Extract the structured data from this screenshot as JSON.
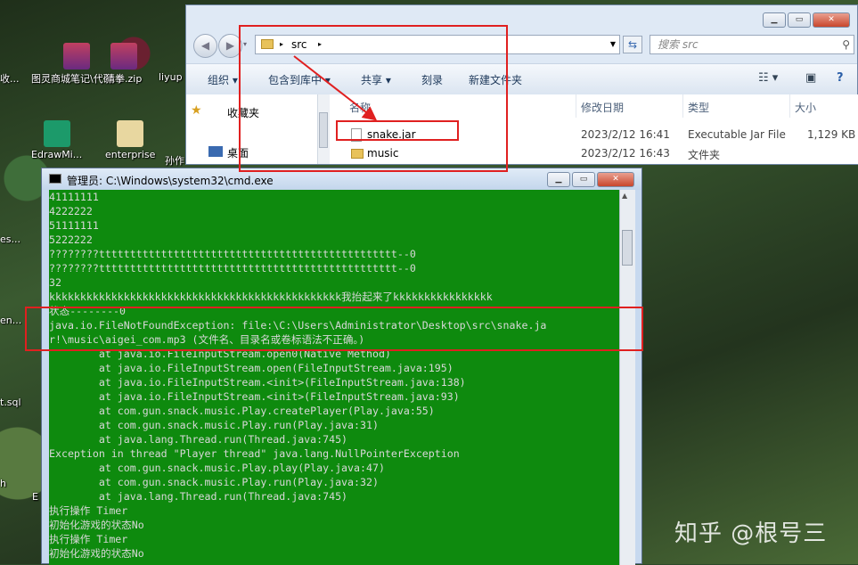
{
  "desktop": {
    "icons": [
      {
        "label": "图灵商城笔记\\代码..."
      },
      {
        "label": "猜拳.zip"
      },
      {
        "label": "liyup"
      },
      {
        "label": "EdrawMi..."
      },
      {
        "label": "enterprise"
      },
      {
        "label": "孙作"
      },
      {
        "label": "收..."
      },
      {
        "label": "es..."
      },
      {
        "label": "en..."
      },
      {
        "label": "t.sql"
      },
      {
        "label": "h"
      },
      {
        "label": "E"
      }
    ]
  },
  "explorer": {
    "address": {
      "crumb": "src",
      "sep": "▸"
    },
    "search_placeholder": "搜索 src",
    "toolbar": {
      "organize": "组织 ▾",
      "include_in_library": "包含到库中 ▾",
      "share": "共享 ▾",
      "burn": "刻录",
      "new_folder": "新建文件夹"
    },
    "nav": {
      "favorites": "收藏夹",
      "desktop": "桌面"
    },
    "columns": {
      "name": "名称",
      "date": "修改日期",
      "type": "类型",
      "size": "大小"
    },
    "files": [
      {
        "name": "snake.jar",
        "date": "2023/2/12 16:41",
        "type": "Executable Jar File",
        "size": "1,129 KB"
      },
      {
        "name": "music",
        "date": "2023/2/12 16:43",
        "type": "文件夹",
        "size": ""
      }
    ]
  },
  "cmd": {
    "title": "管理员: C:\\Windows\\system32\\cmd.exe",
    "lines": [
      "41111111",
      "4222222",
      "51111111",
      "5222222",
      "????????tttttttttttttttttttttttttttttttttttttttttttttttt--0",
      "????????tttttttttttttttttttttttttttttttttttttttttttttttt--0",
      "32",
      "kkkkkkkkkkkkkkkkkkkkkkkkkkkkkkkkkkkkkkkkkkkkkkk我抬起来了kkkkkkkkkkkkkkkk",
      "状态--------0",
      "java.io.FileNotFoundException: file:\\C:\\Users\\Administrator\\Desktop\\src\\snake.ja",
      "r!\\music\\aigei_com.mp3 (文件名、目录名或卷标语法不正确。)",
      "        at java.io.FileInputStream.open0(Native Method)",
      "        at java.io.FileInputStream.open(FileInputStream.java:195)",
      "        at java.io.FileInputStream.<init>(FileInputStream.java:138)",
      "        at java.io.FileInputStream.<init>(FileInputStream.java:93)",
      "        at com.gun.snack.music.Play.createPlayer(Play.java:55)",
      "        at com.gun.snack.music.Play.run(Play.java:31)",
      "        at java.lang.Thread.run(Thread.java:745)",
      "Exception in thread \"Player thread\" java.lang.NullPointerException",
      "        at com.gun.snack.music.Play.play(Play.java:47)",
      "        at com.gun.snack.music.Play.run(Play.java:32)",
      "        at java.lang.Thread.run(Thread.java:745)",
      "执行操作 Timer",
      "初始化游戏的状态No",
      "执行操作 Timer",
      "初始化游戏的状态No"
    ]
  },
  "watermark": "知乎 @根号三",
  "colors": {
    "console_bg": "#0e8a0e",
    "annotation": "#e02020"
  }
}
